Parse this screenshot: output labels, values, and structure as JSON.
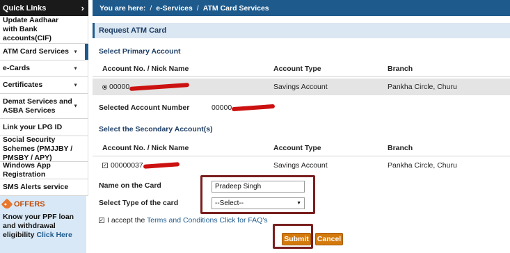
{
  "sidebar": {
    "header": "Quick Links",
    "items": [
      {
        "label": "Update Aadhaar with Bank accounts(CIF)",
        "dropdown": false
      },
      {
        "label": "ATM Card Services",
        "dropdown": true
      },
      {
        "label": "e-Cards",
        "dropdown": true
      },
      {
        "label": "Certificates",
        "dropdown": true
      },
      {
        "label": "Demat Services and ASBA Services",
        "dropdown": true
      },
      {
        "label": "Link your LPG ID",
        "dropdown": false
      },
      {
        "label": "Social Security Schemes (PMJJBY / PMSBY / APY)",
        "dropdown": false
      },
      {
        "label": "Windows App Registration",
        "dropdown": false
      },
      {
        "label": "SMS Alerts service",
        "dropdown": false
      }
    ],
    "offers": {
      "title": "OFFERS",
      "text": "Know your PPF loan and withdrawal eligibility",
      "link": "Click Here"
    }
  },
  "breadcrumb": {
    "prefix": "You are here:",
    "items": [
      "e-Services",
      "ATM Card Services"
    ],
    "separator": "/"
  },
  "panel": {
    "title": "Request ATM Card",
    "primary": {
      "label": "Select Primary Account",
      "headers": [
        "Account No. / Nick Name",
        "Account Type",
        "Branch"
      ],
      "row": {
        "account": "00000",
        "type": "Savings Account",
        "branch": "Pankha Circle, Churu"
      }
    },
    "selected": {
      "label": "Selected Account Number",
      "value": "00000"
    },
    "secondary": {
      "label": "Select the Secondary Account(s)",
      "headers": [
        "Account No. / Nick Name",
        "Account Type",
        "Branch"
      ],
      "row": {
        "account": "00000037",
        "type": "Savings Account",
        "branch": "Pankha Circle, Churu"
      }
    },
    "form": {
      "name_label": "Name on the Card",
      "name_value": "Pradeep Singh",
      "type_label": "Select Type of the card",
      "type_selected": "--Select--",
      "terms_prefix": "I accept the",
      "terms_link": "Terms and Conditions",
      "faq_link": "Click for FAQ's"
    },
    "buttons": {
      "submit": "Submit",
      "cancel": "Cancel"
    }
  },
  "colors": {
    "primary_blue": "#1e5a8c",
    "button_orange": "#d4790c",
    "highlight_red": "#7a1f1f",
    "redaction": "#cc1111"
  }
}
